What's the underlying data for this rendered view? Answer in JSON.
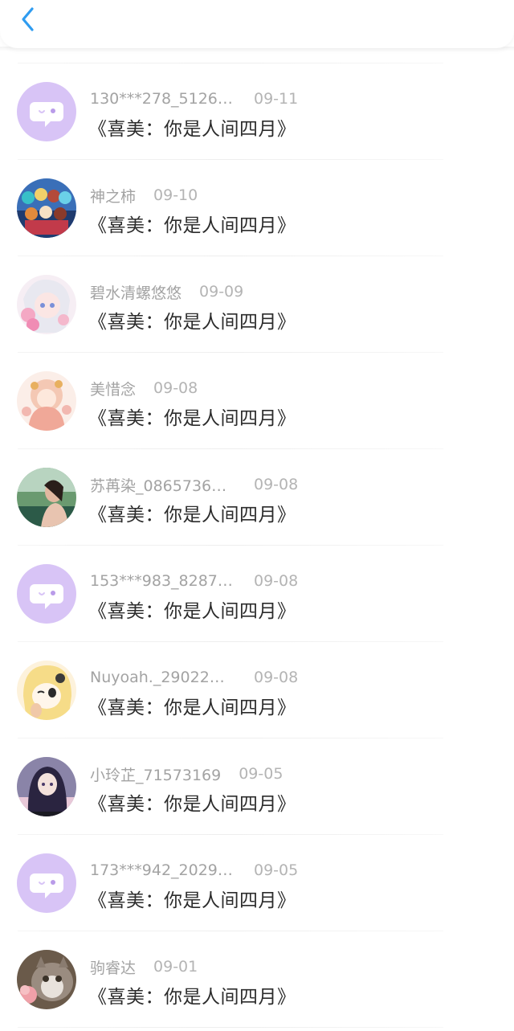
{
  "header": {
    "back_icon": "chevron-left-icon",
    "accent_color": "#2f9cf0"
  },
  "messages": [
    {
      "name": "130***278_5126…",
      "date": "09-11",
      "title": "《喜美：你是人间四月》",
      "avatar": "default-chat-avatar",
      "truncated": true
    },
    {
      "name": "神之柿",
      "date": "09-10",
      "title": "《喜美：你是人间四月》",
      "avatar": "anime-group-avatar",
      "truncated": false
    },
    {
      "name": "碧水清螺悠悠",
      "date": "09-09",
      "title": "《喜美：你是人间四月》",
      "avatar": "anime-girl-pink-avatar",
      "truncated": false
    },
    {
      "name": "美惜念",
      "date": "09-08",
      "title": "《喜美：你是人间四月》",
      "avatar": "illustration-girl-avatar",
      "truncated": false
    },
    {
      "name": "苏苒染_0865736…",
      "date": "09-08",
      "title": "《喜美：你是人间四月》",
      "avatar": "photo-woman-avatar",
      "truncated": true
    },
    {
      "name": "153***983_8287…",
      "date": "09-08",
      "title": "《喜美：你是人间四月》",
      "avatar": "default-chat-avatar",
      "truncated": true
    },
    {
      "name": "Nuyoah._29022…",
      "date": "09-08",
      "title": "《喜美：你是人间四月》",
      "avatar": "cartoon-girl-avatar",
      "truncated": true
    },
    {
      "name": "小玲芷_71573169",
      "date": "09-05",
      "title": "《喜美：你是人间四月》",
      "avatar": "anime-dark-hair-avatar",
      "truncated": false
    },
    {
      "name": "173***942_2029…",
      "date": "09-05",
      "title": "《喜美：你是人间四月》",
      "avatar": "default-chat-avatar",
      "truncated": true
    },
    {
      "name": "驹睿达",
      "date": "09-01",
      "title": "《喜美：你是人间四月》",
      "avatar": "cat-photo-avatar",
      "truncated": false
    }
  ]
}
